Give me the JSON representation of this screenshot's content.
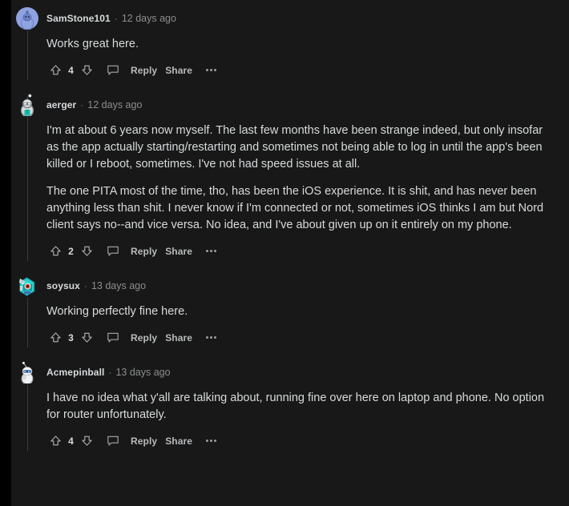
{
  "theme": {
    "page_background": "#000000",
    "panel_background": "#181818",
    "text_color": "#d7dadc",
    "muted_text_color": "#8b8d8f",
    "threadline_color": "#3c3d3e"
  },
  "actions": {
    "reply_label": "Reply",
    "share_label": "Share",
    "upvote_icon": "upvote-arrow-icon",
    "downvote_icon": "downvote-arrow-icon",
    "comment_icon": "comment-bubble-icon",
    "more_icon": "more-options-icon",
    "separator": "·"
  },
  "comments": [
    {
      "id": "comment-1",
      "username": "SamStone101",
      "timestamp": "12 days ago",
      "score": "4",
      "avatar": "avatar-blue-snoo",
      "paragraphs": [
        "Works great here."
      ]
    },
    {
      "id": "comment-2",
      "username": "aerger",
      "timestamp": "12 days ago",
      "score": "2",
      "avatar": "avatar-grey-sunglasses-snoo",
      "paragraphs": [
        "I'm at about 6 years now myself. The last few months have been strange indeed, but only insofar as the app actually starting/restarting and sometimes not being able to log in until the app's been killed or I reboot, sometimes. I've not had speed issues at all.",
        "The one PITA most of the time, tho, has been the iOS experience. It is shit, and has never been anything less than shit. I never know if I'm connected or not, sometimes iOS thinks I am but Nord client says no--and vice versa. No idea, and I've about given up on it entirely on my phone."
      ]
    },
    {
      "id": "comment-3",
      "username": "soysux",
      "timestamp": "13 days ago",
      "score": "3",
      "avatar": "avatar-teal-robot-snoo",
      "paragraphs": [
        "Working perfectly fine here."
      ]
    },
    {
      "id": "comment-4",
      "username": "Acmepinball",
      "timestamp": "13 days ago",
      "score": "4",
      "avatar": "avatar-white-visor-snoo",
      "paragraphs": [
        "I have no idea what y'all are talking about, running fine over here on laptop and phone. No option for router unfortunately."
      ]
    }
  ]
}
